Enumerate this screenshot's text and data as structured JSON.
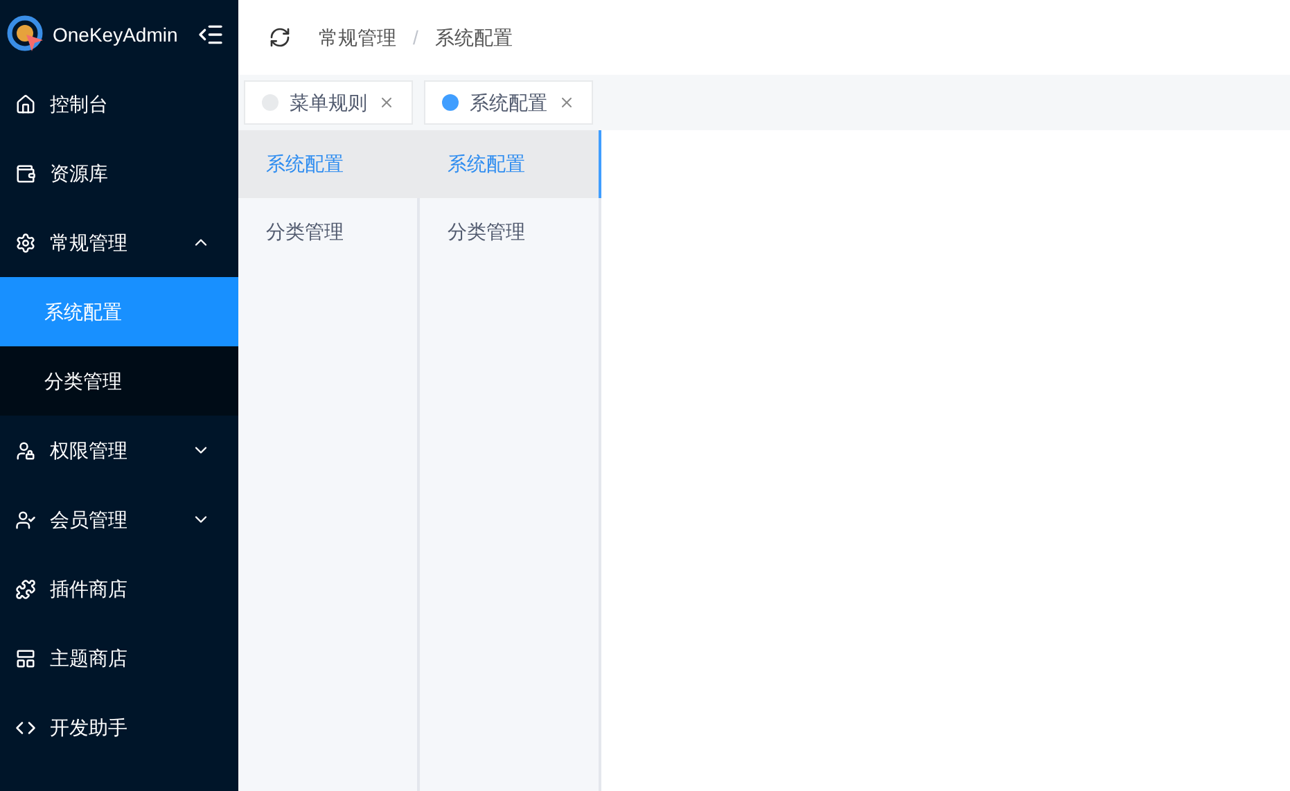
{
  "brand": "OneKeyAdmin",
  "sidebar": {
    "items": [
      {
        "label": "控制台",
        "kind": "link"
      },
      {
        "label": "资源库",
        "kind": "link"
      },
      {
        "label": "常规管理",
        "kind": "group",
        "expanded": true,
        "children": [
          {
            "label": "系统配置",
            "selected": true
          },
          {
            "label": "分类管理",
            "selected": false
          }
        ]
      },
      {
        "label": "权限管理",
        "kind": "group",
        "expanded": false
      },
      {
        "label": "会员管理",
        "kind": "group",
        "expanded": false
      },
      {
        "label": "插件商店",
        "kind": "link"
      },
      {
        "label": "主题商店",
        "kind": "link"
      },
      {
        "label": "开发助手",
        "kind": "link"
      }
    ]
  },
  "breadcrumb": {
    "separator": "/",
    "items": [
      "常规管理",
      "系统配置"
    ]
  },
  "tabs": [
    {
      "label": "菜单规则",
      "selected": false
    },
    {
      "label": "系统配置",
      "selected": true
    }
  ],
  "panels": [
    {
      "focused": false,
      "items": [
        {
          "label": "系统配置",
          "selected": true
        },
        {
          "label": "分类管理",
          "selected": false
        }
      ]
    },
    {
      "focused": true,
      "items": [
        {
          "label": "系统配置",
          "selected": true
        },
        {
          "label": "分类管理",
          "selected": false
        }
      ]
    }
  ]
}
